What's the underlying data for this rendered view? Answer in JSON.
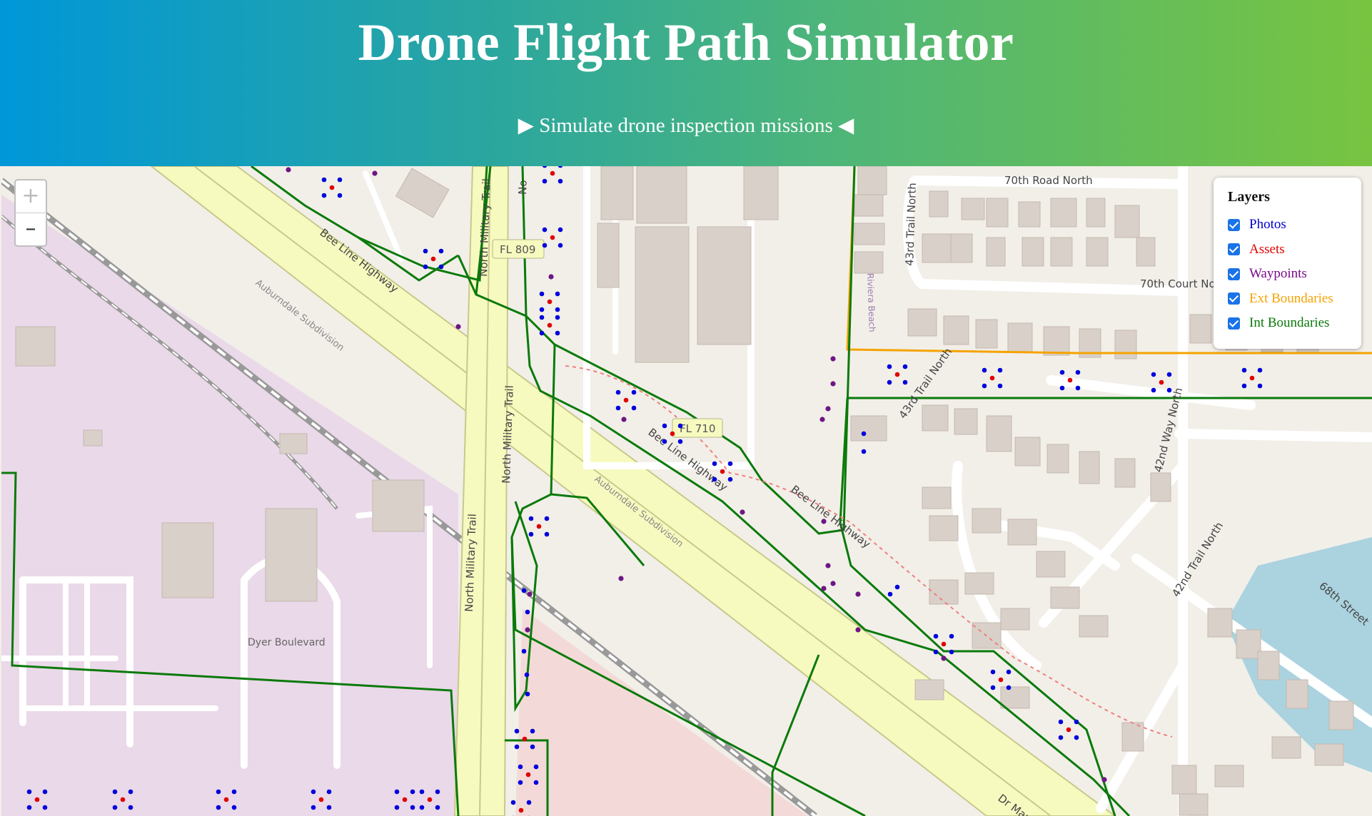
{
  "header": {
    "title": "Drone Flight Path Simulator",
    "subtitle": "▶ Simulate drone inspection missions ◀"
  },
  "map": {
    "zoom_in": "+",
    "zoom_out": "–",
    "road_labels": {
      "bee_line_1": "Bee Line Highway",
      "bee_line_2": "Bee Line Highway",
      "bee_line_3": "Bee Line Highway",
      "north_military_1": "North Military Trail",
      "north_military_2": "North Military Trail",
      "north_military_3": "North Military Trail",
      "fl809": "FL 809",
      "fl710": "FL 710",
      "auburndale_1": "Auburndale Subdivision",
      "auburndale_2": "Auburndale Subdivision",
      "road_70th": "70th Road North",
      "court_70th": "70th Court No",
      "trail_43rd": "43rd Trail North",
      "trail_43rd_b": "43rd Trail North",
      "way_42nd": "42nd Way North",
      "trail_42nd": "42nd Trail North",
      "street_68th": "68th Street",
      "riviera": "Riviera Beach",
      "dyer": "Dyer Boulevard",
      "dr_mar": "Dr Mar",
      "no": "No"
    }
  },
  "layers": {
    "title": "Layers",
    "items": [
      {
        "label": "Photos",
        "color": "#0000cc",
        "checked": true
      },
      {
        "label": "Assets",
        "color": "#e00000",
        "checked": true
      },
      {
        "label": "Waypoints",
        "color": "#7a0a8a",
        "checked": true
      },
      {
        "label": "Ext Boundaries",
        "color": "#f5a300",
        "checked": true
      },
      {
        "label": "Int Boundaries",
        "color": "#0a7a0a",
        "checked": true
      }
    ]
  },
  "colors": {
    "photo": "#0000dd",
    "asset": "#e00000",
    "waypoint": "#6f1685",
    "ext_boundary": "#f5a300",
    "int_boundary": "#0a7a0a"
  }
}
